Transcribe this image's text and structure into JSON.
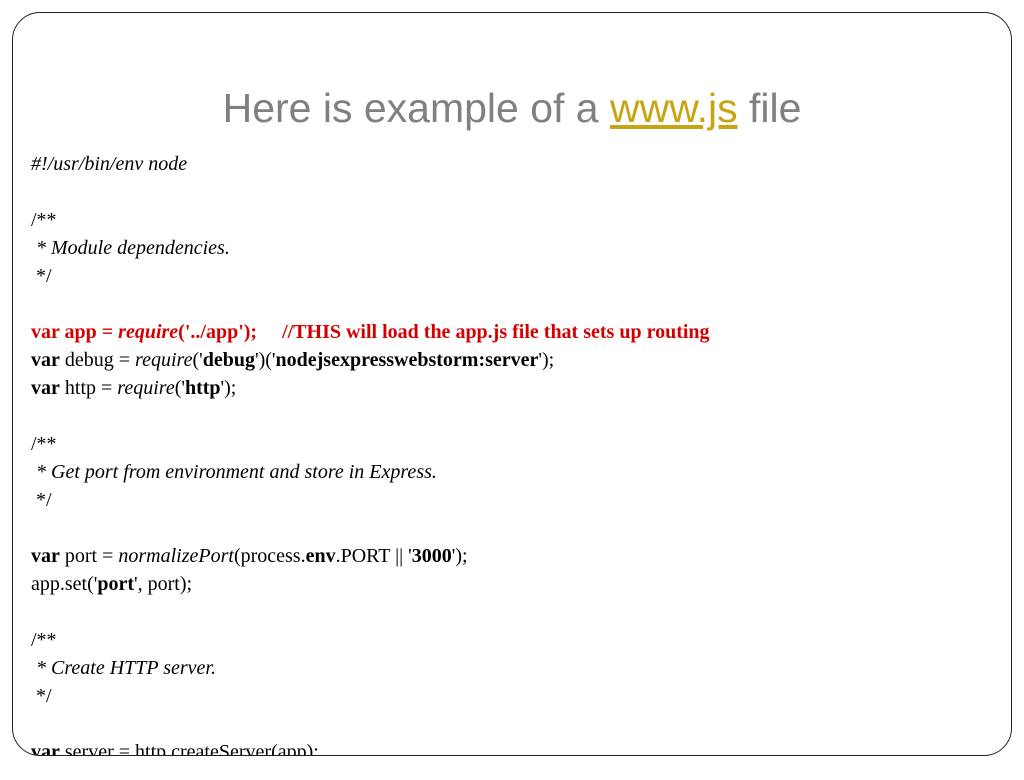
{
  "title_prefix": "Here is example of a ",
  "title_link": "www.js",
  "title_suffix": " file",
  "lines": {
    "l1": "#!/usr/bin/env node",
    "l2": "",
    "l3": "/**",
    "l4": " * Module dependencies.",
    "l5": " */",
    "l6": "",
    "r1_a": "var app = ",
    "r1_b": "require",
    "r1_c": "('../app');     //THIS will load the app.js file that sets up routing",
    "l8_a": "var",
    "l8_b": " debug = ",
    "l8_c": "require",
    "l8_d": "('",
    "l8_e": "debug",
    "l8_f": "')('",
    "l8_g": "nodejsexpresswebstorm:server",
    "l8_h": "');",
    "l9_a": "var",
    "l9_b": " http = ",
    "l9_c": "require",
    "l9_d": "('",
    "l9_e": "http",
    "l9_f": "');",
    "l10": "",
    "l11": "/**",
    "l12": " * Get port from environment and store in Express.",
    "l13": " */",
    "l14": "",
    "l15_a": "var",
    "l15_b": " port = ",
    "l15_c": "normalizePort",
    "l15_d": "(process.",
    "l15_e": "env",
    "l15_f": ".PORT || '",
    "l15_g": "3000",
    "l15_h": "');",
    "l16_a": "app.set('",
    "l16_b": "port",
    "l16_c": "', port);",
    "l17": "",
    "l18": "/**",
    "l19": " * Create HTTP server.",
    "l20": " */",
    "l21": "",
    "l22_a": "var",
    "l22_b": " server = http.createServer(app);"
  }
}
